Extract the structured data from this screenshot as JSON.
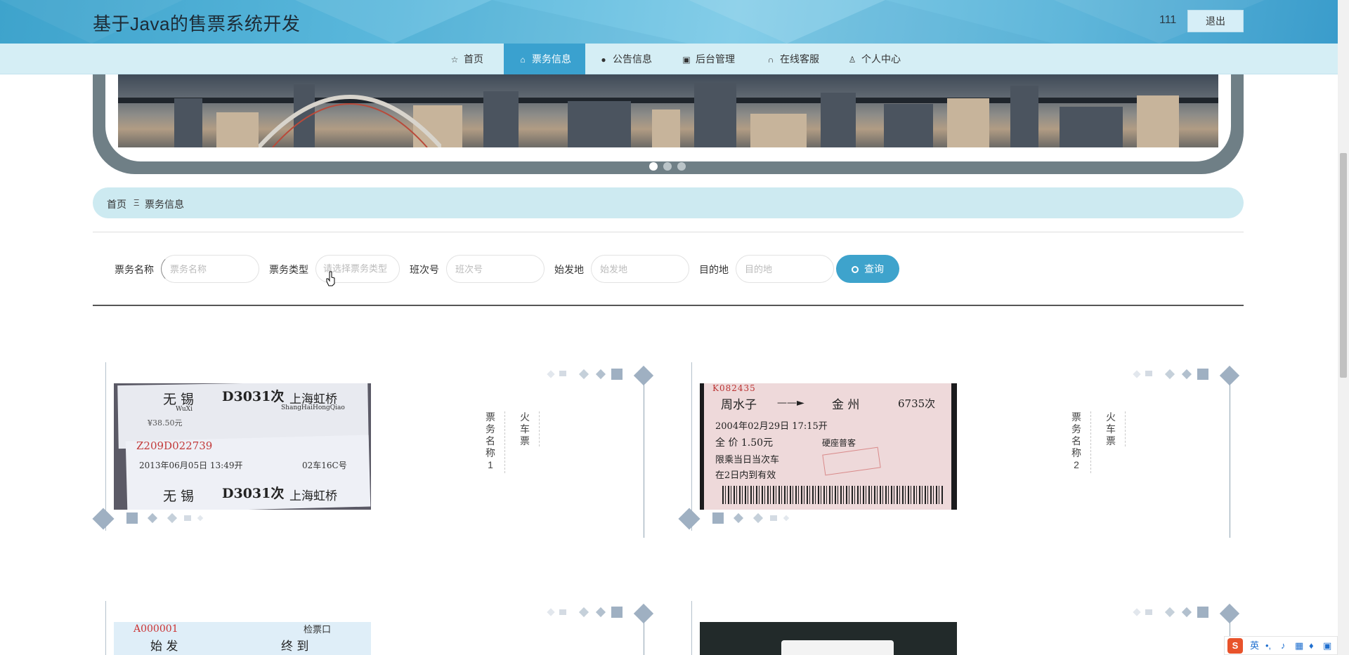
{
  "header": {
    "title": "基于Java的售票系统开发",
    "username": "111",
    "logout_label": "退出"
  },
  "nav": {
    "items": [
      {
        "label": "首页",
        "icon": "star-icon"
      },
      {
        "label": "票务信息",
        "icon": "bag-icon",
        "active": true
      },
      {
        "label": "公告信息",
        "icon": "alert-icon"
      },
      {
        "label": "后台管理",
        "icon": "briefcase-icon"
      },
      {
        "label": "在线客服",
        "icon": "headset-icon"
      },
      {
        "label": "个人中心",
        "icon": "user-icon"
      }
    ]
  },
  "carousel": {
    "slide_count": 3,
    "active_index": 0
  },
  "breadcrumb": {
    "home": "首页",
    "separator": "Ξ",
    "current": "票务信息"
  },
  "search": {
    "name_label": "票务名称",
    "name_placeholder": "票务名称",
    "type_label": "票务类型",
    "type_placeholder": "请选择票务类型",
    "number_label": "班次号",
    "number_placeholder": "班次号",
    "from_label": "始发地",
    "from_placeholder": "始发地",
    "to_label": "目的地",
    "to_placeholder": "目的地",
    "button_label": "查询"
  },
  "tickets": [
    {
      "name": "票务名称1",
      "type": "火车票",
      "art": {
        "from": "无 锡",
        "train": "D3031次",
        "to": "上海虹桥",
        "from_py": "WuXi",
        "to_py": "ShangHaiHongQiao",
        "price": "¥38.50元",
        "serial": "Z209D022739",
        "date": "2013年06月05日 13:49开",
        "seat": "02车16C号"
      }
    },
    {
      "name": "票务名称2",
      "type": "火车票",
      "art": {
        "code": "K082435",
        "from": "周水子",
        "to": "金 州",
        "train": "6735次",
        "date": "2004年02月29日 17:15开",
        "price": "全 价 1.50元",
        "note": "限乘当日当次车",
        "note2": "在2日内到有效",
        "seat_type": "硬座普客"
      }
    },
    {
      "name": "",
      "type": "",
      "art": {
        "code": "A000001",
        "from": "始 发",
        "to": "终 到",
        "gate": "检票口"
      }
    },
    {
      "name": "",
      "type": "",
      "art": {}
    }
  ],
  "ime": {
    "lang": "英"
  },
  "colors": {
    "accent": "#3ea3cc",
    "nav_bg": "#d5eef5",
    "breadcrumb_bg": "#cdeaf1"
  }
}
